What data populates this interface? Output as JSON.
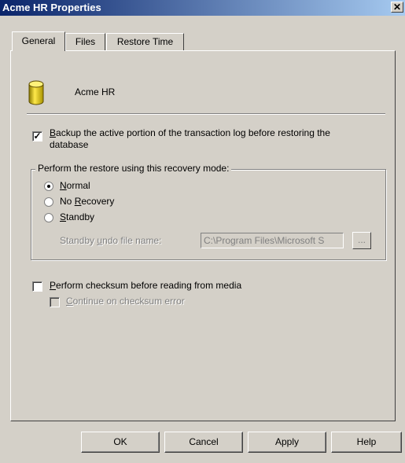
{
  "window": {
    "title": "Acme HR Properties",
    "close_glyph": "✕"
  },
  "tabs": [
    {
      "label": "General",
      "active": true
    },
    {
      "label": "Files",
      "active": false
    },
    {
      "label": "Restore Time",
      "active": false
    }
  ],
  "general": {
    "database_name": "Acme HR",
    "database_icon": "database-cylinder-icon",
    "backup_tail_log": {
      "checked": true,
      "label_line1_mnemonic": "B",
      "label_line1_rest": "ackup the active portion of the transaction log before restoring the",
      "label_line2": "database"
    },
    "recovery_group": {
      "legend": "Perform the restore using this recovery mode:",
      "options": [
        {
          "mnemonic": "N",
          "rest": "ormal",
          "prefix": "",
          "checked": true
        },
        {
          "prefix": "No ",
          "mnemonic": "R",
          "rest": "ecovery",
          "checked": false
        },
        {
          "prefix": "",
          "mnemonic": "S",
          "rest": "tandby",
          "checked": false
        }
      ],
      "standby_undo_label_prefix": "Standby ",
      "standby_undo_label_mnemonic": "u",
      "standby_undo_label_rest": "ndo file name:",
      "standby_undo_value": "C:\\Program Files\\Microsoft S",
      "browse_label": "..."
    },
    "checksum": {
      "checked": false,
      "mnemonic": "P",
      "rest": "erform checksum before reading from media"
    },
    "continue_on_error": {
      "checked": false,
      "enabled": false,
      "mnemonic": "C",
      "rest": "ontinue on checksum error"
    }
  },
  "buttons": {
    "ok": "OK",
    "cancel": "Cancel",
    "apply": "Apply",
    "help": "Help"
  },
  "colors": {
    "face": "#d4d0c8",
    "title_start": "#0a246a",
    "title_end": "#a6caf0",
    "db_icon": "#e6c800"
  }
}
